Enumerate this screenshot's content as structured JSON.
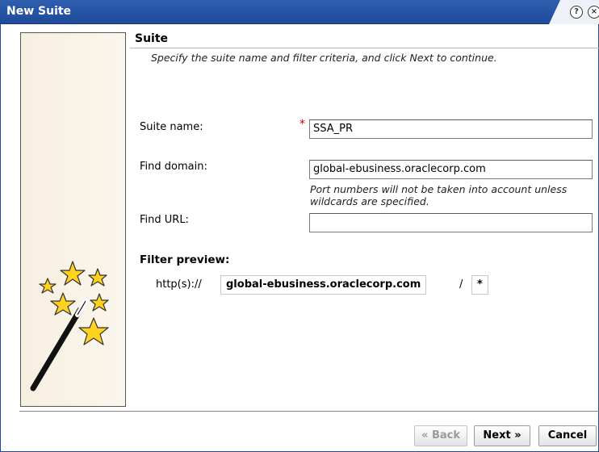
{
  "window": {
    "title": "New Suite",
    "help_icon_glyph": "?",
    "close_icon_glyph": "×"
  },
  "section": {
    "title": "Suite",
    "instructions": "Specify the suite name and filter criteria, and click Next to continue."
  },
  "form": {
    "suite_name_label": "Suite name:",
    "suite_name_value": "SSA_PR",
    "required_marker": "*",
    "find_domain_label": "Find domain:",
    "find_domain_value": "global-ebusiness.oraclecorp.com",
    "domain_hint": "Port numbers will not be taken into account unless wildcards are specified.",
    "find_url_label": "Find URL:",
    "find_url_value": ""
  },
  "preview": {
    "title": "Filter preview:",
    "protocol": "http(s)://",
    "domain": "global-ebusiness.oraclecorp.com",
    "separator": "/",
    "path": "*"
  },
  "buttons": {
    "back": "« Back",
    "next": "Next »",
    "cancel": "Cancel"
  },
  "icons": {
    "wizard": "magic-wand-stars-icon",
    "help": "help-icon",
    "close": "close-icon"
  },
  "colors": {
    "titlebar": "#1e4a98",
    "required": "#d00000",
    "star_fill": "#ffd21f",
    "disabled_text": "#9a9a9a"
  }
}
